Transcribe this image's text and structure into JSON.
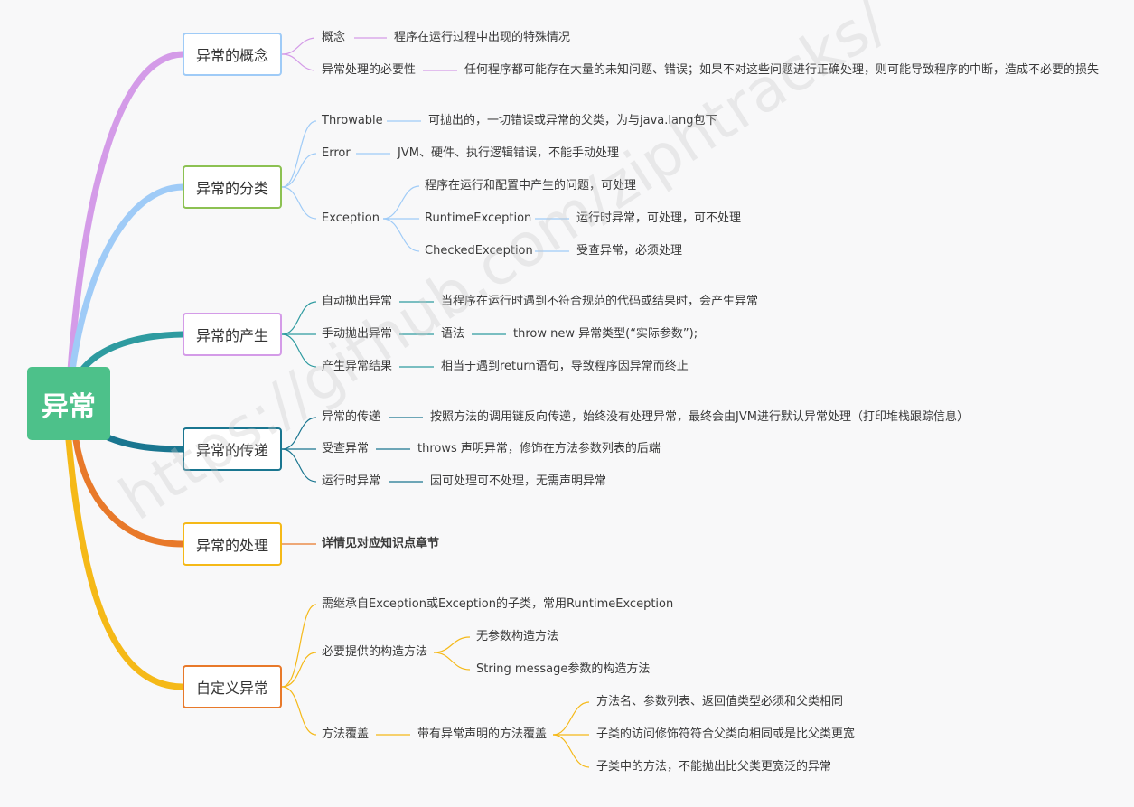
{
  "root": {
    "label": "异常"
  },
  "watermark": "https://github.com/ziphtracks/",
  "colors": {
    "purple": "#d49be8",
    "lightblue": "#9fcbf7",
    "green": "#8cc152",
    "teal": "#2e9ba0",
    "darkteal": "#1a7690",
    "orange": "#e8792a",
    "yellow": "#f5b918",
    "root": "#4dc18a"
  },
  "branches": {
    "concept": {
      "label": "异常的概念",
      "items": [
        {
          "key": "概念",
          "value": "程序在运行过程中出现的特殊情况"
        },
        {
          "key": "异常处理的必要性",
          "value": "任何程序都可能存在大量的未知问题、错误；如果不对这些问题进行正确处理，则可能导致程序的中断，造成不必要的损失"
        }
      ]
    },
    "classification": {
      "label": "异常的分类",
      "items": [
        {
          "key": "Throwable",
          "value": "可抛出的，一切错误或异常的父类，为与java.lang包下"
        },
        {
          "key": "Error",
          "value": "JVM、硬件、执行逻辑错误，不能手动处理"
        },
        {
          "key": "Exception",
          "children": [
            {
              "key": "程序在运行和配置中产生的问题，可处理"
            },
            {
              "key": "RuntimeException",
              "value": "运行时异常，可处理，可不处理"
            },
            {
              "key": "CheckedException",
              "value": "受查异常，必须处理"
            }
          ]
        }
      ]
    },
    "generation": {
      "label": "异常的产生",
      "items": [
        {
          "key": "自动抛出异常",
          "value": "当程序在运行时遇到不符合规范的代码或结果时，会产生异常"
        },
        {
          "key": "手动抛出异常",
          "value": "语法",
          "sub": "throw new 异常类型(“实际参数”);"
        },
        {
          "key": "产生异常结果",
          "value": "相当于遇到return语句，导致程序因异常而终止"
        }
      ]
    },
    "propagation": {
      "label": "异常的传递",
      "items": [
        {
          "key": "异常的传递",
          "value": "按照方法的调用链反向传递，始终没有处理异常，最终会由JVM进行默认异常处理（打印堆栈跟踪信息）"
        },
        {
          "key": "受查异常",
          "value": "throws 声明异常，修饰在方法参数列表的后端"
        },
        {
          "key": "运行时异常",
          "value": "因可处理可不处理，无需声明异常"
        }
      ]
    },
    "handling": {
      "label": "异常的处理",
      "items": [
        {
          "key": "详情见对应知识点章节"
        }
      ]
    },
    "custom": {
      "label": "自定义异常",
      "items": [
        {
          "key": "需继承自Exception或Exception的子类，常用RuntimeException"
        },
        {
          "key": "必要提供的构造方法",
          "children": [
            {
              "key": "无参数构造方法"
            },
            {
              "key": "String message参数的构造方法"
            }
          ]
        },
        {
          "key": "方法覆盖",
          "value": "带有异常声明的方法覆盖",
          "children": [
            {
              "key": "方法名、参数列表、返回值类型必须和父类相同"
            },
            {
              "key": "子类的访问修饰符符合父类向相同或是比父类更宽"
            },
            {
              "key": "子类中的方法，不能抛出比父类更宽泛的异常"
            }
          ]
        }
      ]
    }
  }
}
